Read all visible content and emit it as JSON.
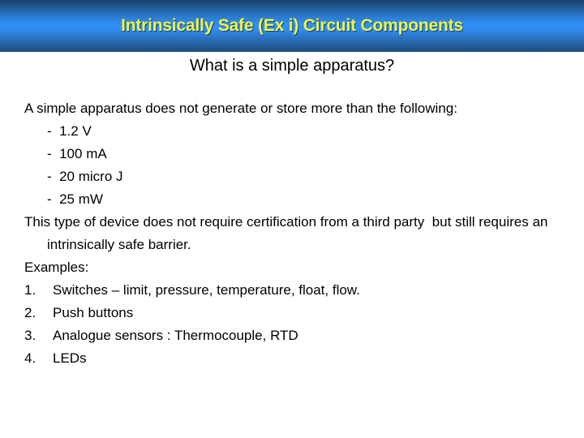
{
  "slide": {
    "title": "Intrinsically Safe (Ex i) Circuit Components",
    "subtitle": "What is a simple apparatus?",
    "colors": {
      "title_text": "#f2f542",
      "banner_top": "#1d4b7a",
      "banner_mid": "#2f90f5",
      "banner_bottom": "#1f5489",
      "body_text": "#000000",
      "background": "#ffffff"
    },
    "body": {
      "intro_paragraph": "A simple apparatus does not generate or store more than the following:",
      "limits": [
        "-  1.2 V",
        "-  100 mA",
        "-  20 micro J",
        "-  25 mW"
      ],
      "certification_paragraph": "This type of device does not require certification from a third party  but still requires an intrinsically safe barrier.",
      "examples_label": "Examples:",
      "examples": [
        {
          "number": "1.",
          "text": "Switches – limit, pressure, temperature, float, flow."
        },
        {
          "number": "2.",
          "text": "Push buttons"
        },
        {
          "number": "3.",
          "text": "Analogue sensors : Thermocouple, RTD"
        },
        {
          "number": "4.",
          "text": "LEDs"
        }
      ]
    }
  }
}
